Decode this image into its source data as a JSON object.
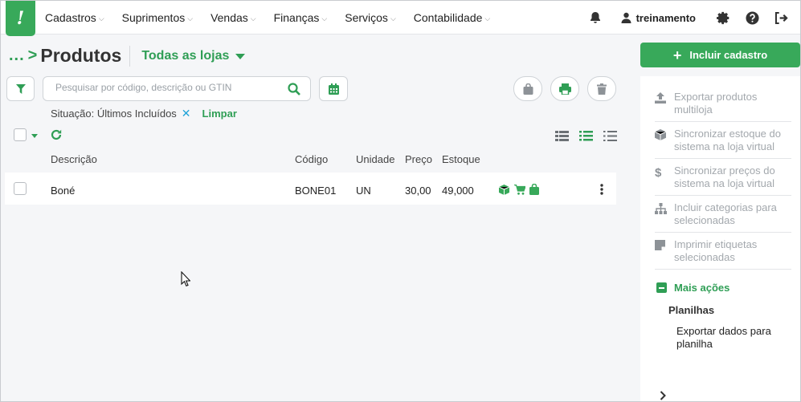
{
  "app": {
    "logo_glyph": "!",
    "brand_color": "#38a95a"
  },
  "menu": [
    {
      "label": "Cadastros"
    },
    {
      "label": "Suprimentos"
    },
    {
      "label": "Vendas"
    },
    {
      "label": "Finanças"
    },
    {
      "label": "Serviços"
    },
    {
      "label": "Contabilidade"
    }
  ],
  "header_icons": [
    "bell-icon",
    "user-icon",
    "gear-icon",
    "help-icon",
    "logout-icon"
  ],
  "user": {
    "name": "treinamento"
  },
  "page": {
    "breadcrumb": "...",
    "title": "Produtos",
    "store_selector": "Todas as lojas"
  },
  "search": {
    "placeholder": "Pesquisar por código, descrição ou GTIN",
    "value": ""
  },
  "filter": {
    "label": "Situação: Últimos Incluídos",
    "remove": "✕",
    "clear": "Limpar"
  },
  "table": {
    "columns": [
      "Descrição",
      "Código",
      "Unidade",
      "Preço",
      "Estoque"
    ],
    "rows": [
      {
        "descricao": "Boné",
        "codigo": "BONE01",
        "unidade": "UN",
        "preco": "30,00",
        "estoque": "49,000",
        "status_icons": [
          "box-icon",
          "cart-icon",
          "bag-icon"
        ]
      }
    ]
  },
  "side": {
    "add_button": "Incluir cadastro",
    "actions": [
      {
        "label": "Exportar produtos multiloja",
        "icon": "upload-icon"
      },
      {
        "label": "Sincronizar estoque do sistema na loja virtual",
        "icon": "cube-icon"
      },
      {
        "label": "Sincronizar preços do sistema na loja virtual",
        "icon": "dollar-icon"
      },
      {
        "label": "Incluir categorias para selecionadas",
        "icon": "sitemap-icon"
      },
      {
        "label": "Imprimir etiquetas selecionadas",
        "icon": "note-icon"
      }
    ],
    "more_actions": "Mais ações",
    "sheets_header": "Planilhas",
    "export_sheet": "Exportar dados para planilha"
  },
  "colors": {
    "accent": "#2f9e55",
    "link_blue": "#1fa3d8",
    "muted": "#a3a8ad"
  }
}
